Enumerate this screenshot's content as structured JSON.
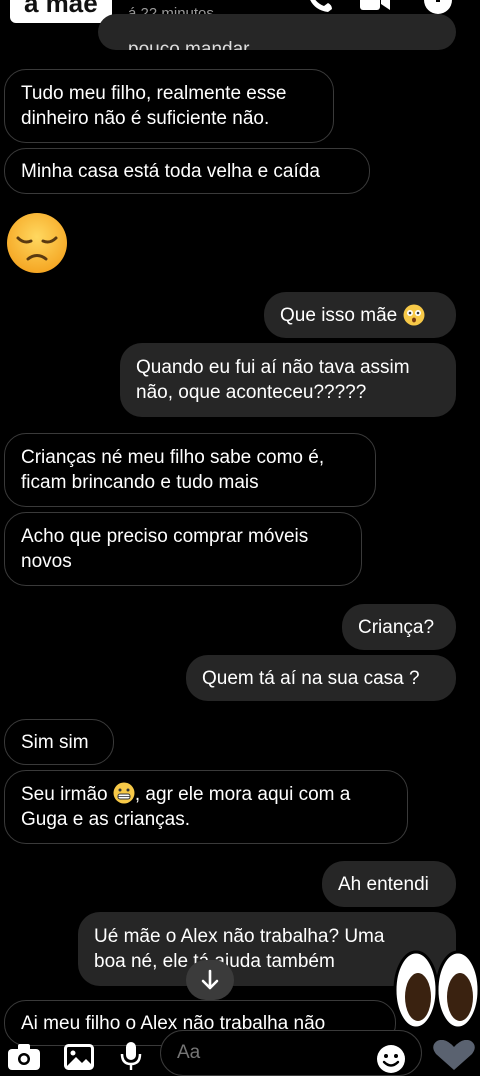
{
  "header": {
    "contact_name": "a mãe",
    "last_seen": "á 22 minutos"
  },
  "messages": [
    {
      "id": "m0",
      "side": "in",
      "text": "pouco mandar"
    },
    {
      "id": "m1",
      "side": "in",
      "text": "Tudo meu filho, realmente esse\ndinheiro não é suficiente não."
    },
    {
      "id": "m2",
      "side": "in",
      "text": "Minha casa está toda velha e caída"
    },
    {
      "id": "m3",
      "side": "in",
      "emoji": "pensive-face"
    },
    {
      "id": "m4",
      "side": "out",
      "text": "Que isso mãe",
      "emoji": "flushed-face"
    },
    {
      "id": "m5",
      "side": "out",
      "text": "Quando eu fui aí não tava assim\nnão, oque aconteceu?????"
    },
    {
      "id": "m6",
      "side": "in",
      "text": "Crianças né meu filho sabe como é,\nficam brincando e tudo mais"
    },
    {
      "id": "m7",
      "side": "in",
      "text": "Acho que preciso comprar móveis\nnovos"
    },
    {
      "id": "m8",
      "side": "out",
      "text": "Criança?"
    },
    {
      "id": "m9",
      "side": "out",
      "text": "Quem tá aí na sua casa ?"
    },
    {
      "id": "m10",
      "side": "in",
      "text": "Sim sim"
    },
    {
      "id": "m11",
      "side": "in",
      "text_a": "Seu irmão ",
      "emoji": "grimacing-face",
      "text_b": ", agr ele mora aqui com a\nGuga e as crianças."
    },
    {
      "id": "m12",
      "side": "out",
      "text": "Ah entendi"
    },
    {
      "id": "m13",
      "side": "out",
      "text": "Ué mãe o Alex não trabalha? Uma\nboa né, ele tá ajuda também"
    },
    {
      "id": "m14",
      "side": "in",
      "text": "Ai meu filho o Alex não trabalha não"
    }
  ],
  "composer": {
    "placeholder": "Aa"
  },
  "icons": {
    "call": "phone-icon",
    "video": "video-icon",
    "info": "info-icon",
    "camera": "camera-icon",
    "gallery": "gallery-icon",
    "mic": "microphone-icon",
    "sticker": "sticker-icon",
    "like": "heart-icon",
    "scroll": "arrow-down-icon"
  },
  "colors": {
    "background": "#000000",
    "incoming_border": "#3a3a3a",
    "outgoing_bubble": "#262626",
    "text": "#ffffff",
    "muted": "#9a9a9a"
  }
}
